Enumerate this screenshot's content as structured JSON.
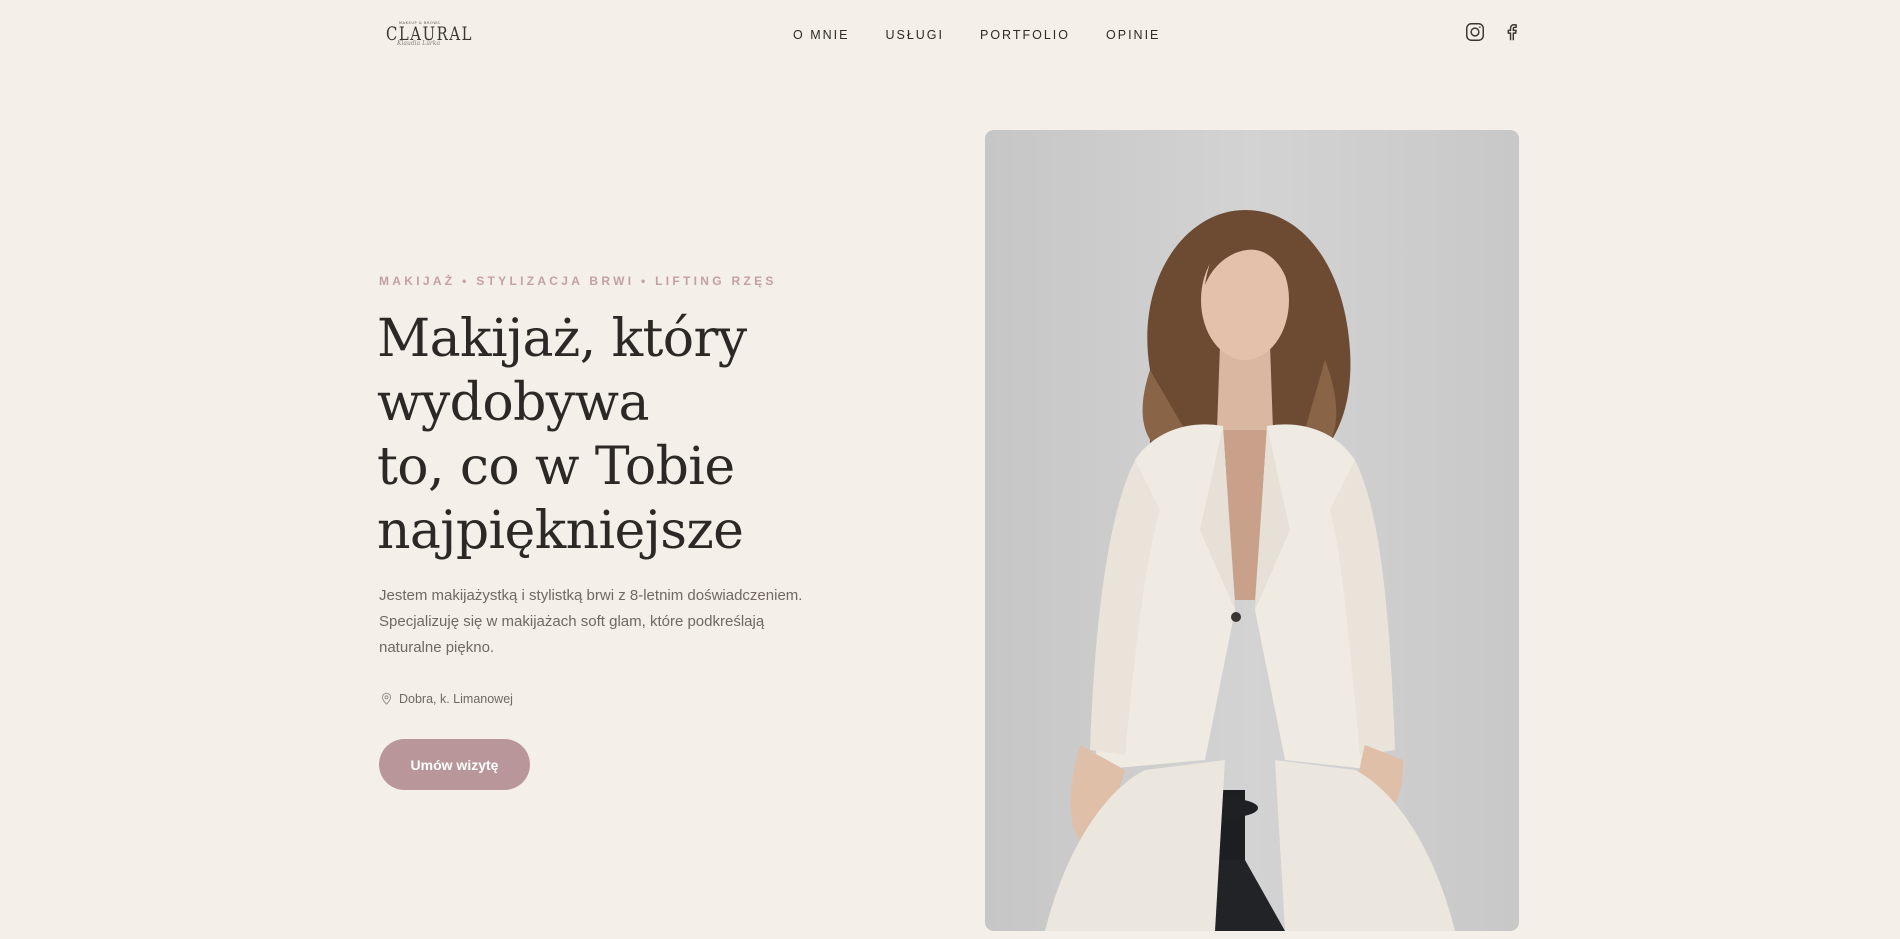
{
  "header": {
    "logo": {
      "top_text": "MAKEUP & BROWS",
      "wordmark": "CLAURAL",
      "script": "Klaudia Lurka"
    },
    "nav": [
      {
        "label": "O MNIE"
      },
      {
        "label": "USŁUGI"
      },
      {
        "label": "PORTFOLIO"
      },
      {
        "label": "OPINIE"
      }
    ],
    "social_icons": [
      "instagram-icon",
      "facebook-icon"
    ]
  },
  "hero": {
    "eyebrow": "MAKIJAŻ • STYLIZACJA BRWI • LIFTING RZĘS",
    "headline_lines": [
      "Makijaż, który",
      "wydobywa",
      "to, co w Tobie",
      "najpiękniejsze"
    ],
    "lead": "Jestem makijażystką i stylistką brwi z 8-letnim doświadczeniem. Specjalizuję się w makijażach soft glam, które podkreślają naturalne piękno.",
    "location": "Dobra, k. Limanowej",
    "cta_label": "Umów wizytę"
  },
  "colors": {
    "background": "#f4efe9",
    "accent": "#b99699",
    "eyebrow": "#c3a0a4",
    "text": "#2b2826",
    "muted": "#6f6864"
  }
}
